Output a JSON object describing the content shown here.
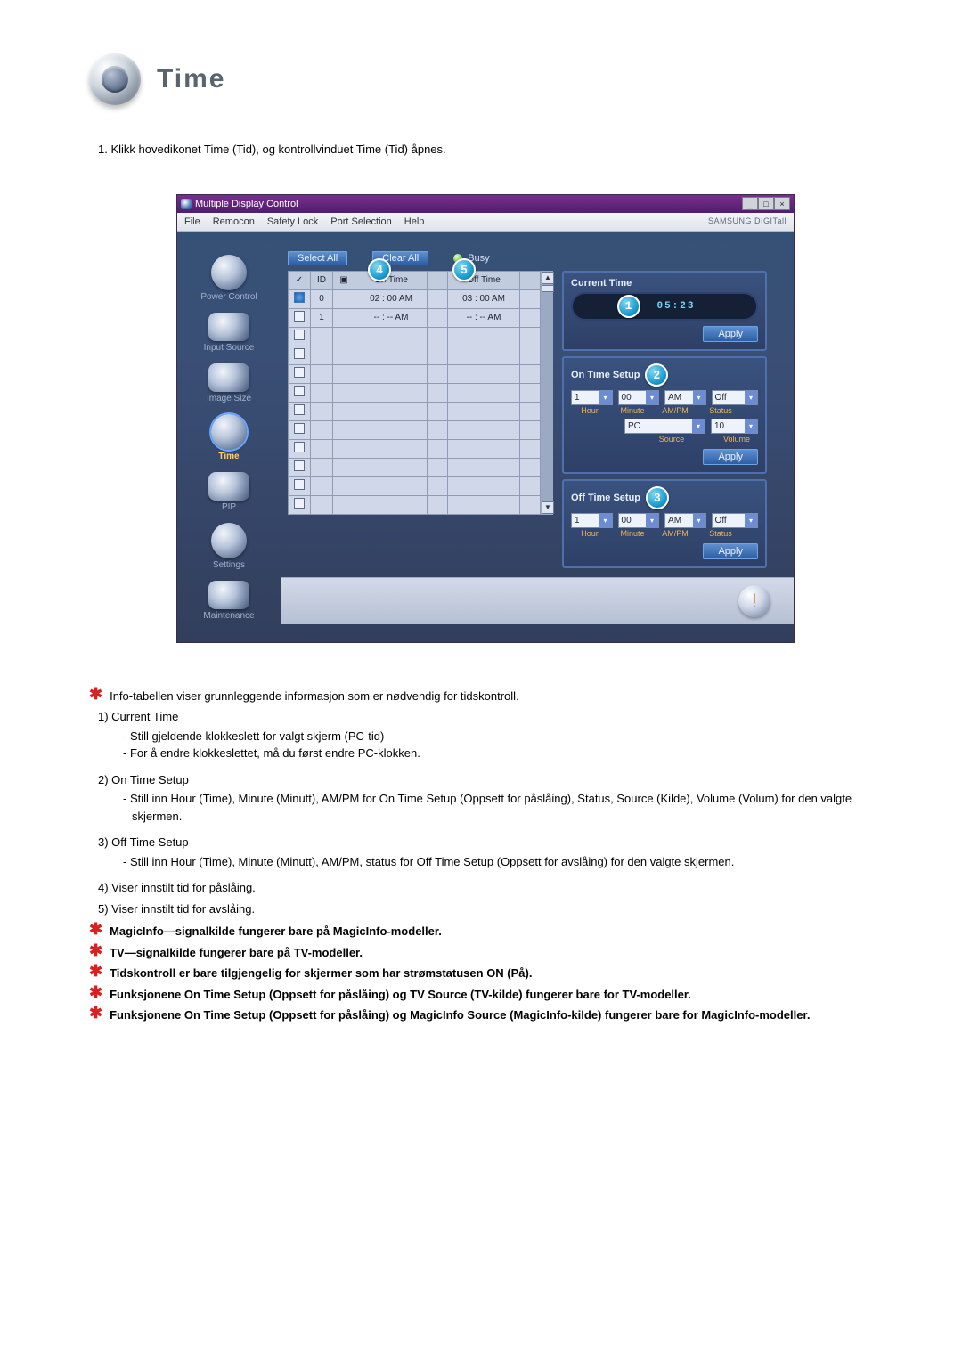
{
  "heading": {
    "title": "Time"
  },
  "intro": {
    "item1": "1.  Klikk hovedikonet Time (Tid), og kontrollvinduet Time (Tid) åpnes."
  },
  "app": {
    "window_title": "Multiple Display Control",
    "brand": "SAMSUNG DIGITall",
    "menus": {
      "file": "File",
      "remocon": "Remocon",
      "safety": "Safety Lock",
      "port": "Port Selection",
      "help": "Help"
    },
    "sidebar": {
      "power": "Power Control",
      "input": "Input Source",
      "image": "Image Size",
      "time": "Time",
      "pip": "PIP",
      "settings": "Settings",
      "maint": "Maintenance"
    },
    "buttons": {
      "select_all": "Select All",
      "clear_all": "Clear All",
      "apply": "Apply"
    },
    "status": {
      "busy": "Busy"
    },
    "table": {
      "headers": {
        "id": "ID",
        "on": "On Time",
        "off": "Off Time"
      },
      "rows": [
        {
          "id": "0",
          "on": "02 : 00 AM",
          "off": "03 : 00 AM",
          "checked": true,
          "monitor": true,
          "dot_on": "green",
          "dot_off": "blue"
        },
        {
          "id": "1",
          "on": "-- : -- AM",
          "off": "-- : -- AM",
          "checked": false,
          "monitor": false,
          "dot_on": "green",
          "dot_off": "blue_dim"
        }
      ]
    },
    "markers": {
      "m1": "1",
      "m2": "2",
      "m3": "3",
      "m4": "4",
      "m5": "5"
    },
    "panels": {
      "current": {
        "title": "Current Time",
        "value": "05:23"
      },
      "on": {
        "title": "On Time Setup",
        "hour": "1",
        "minute": "00",
        "ampm": "AM",
        "status": "Off",
        "source": "PC",
        "volume": "10",
        "labels": {
          "hour": "Hour",
          "minute": "Minute",
          "ampm": "AM/PM",
          "status": "Status",
          "source": "Source",
          "volume": "Volume"
        }
      },
      "off": {
        "title": "Off Time Setup",
        "hour": "1",
        "minute": "00",
        "ampm": "AM",
        "status": "Off",
        "labels": {
          "hour": "Hour",
          "minute": "Minute",
          "ampm": "AM/PM",
          "status": "Status"
        }
      }
    }
  },
  "notes": {
    "n_info": "Info-tabellen viser grunnleggende informasjon som er nødvendig for tidskontroll.",
    "list": {
      "n1_head": "1) Current Time",
      "n1a": "Still gjeldende klokkeslett for valgt skjerm (PC-tid)",
      "n1b": "For å endre klokkeslettet, må du først endre PC-klokken.",
      "n2_head": "2) On Time Setup",
      "n2a": "Still inn Hour (Time), Minute (Minutt), AM/PM for On Time Setup (Oppsett for påslåing), Status, Source (Kilde), Volume (Volum) for den valgte skjermen.",
      "n3_head": "3) Off Time Setup",
      "n3a": "Still inn Hour (Time), Minute (Minutt), AM/PM, status for Off Time Setup (Oppsett for avslåing) for den valgte skjermen.",
      "n4": "4) Viser innstilt tid for påslåing.",
      "n5": "5) Viser innstilt tid for avslåing."
    },
    "star1": "MagicInfo—signalkilde fungerer bare på MagicInfo-modeller.",
    "star2": "TV—signalkilde fungerer bare på TV-modeller.",
    "star3": "Tidskontroll er bare tilgjengelig for skjermer som har strømstatusen ON (På).",
    "star4": "Funksjonene On Time Setup (Oppsett for påslåing) og TV Source (TV-kilde) fungerer bare for TV-modeller.",
    "star5": "Funksjonene On Time Setup (Oppsett for påslåing) og MagicInfo Source (MagicInfo-kilde) fungerer bare for MagicInfo-modeller."
  }
}
